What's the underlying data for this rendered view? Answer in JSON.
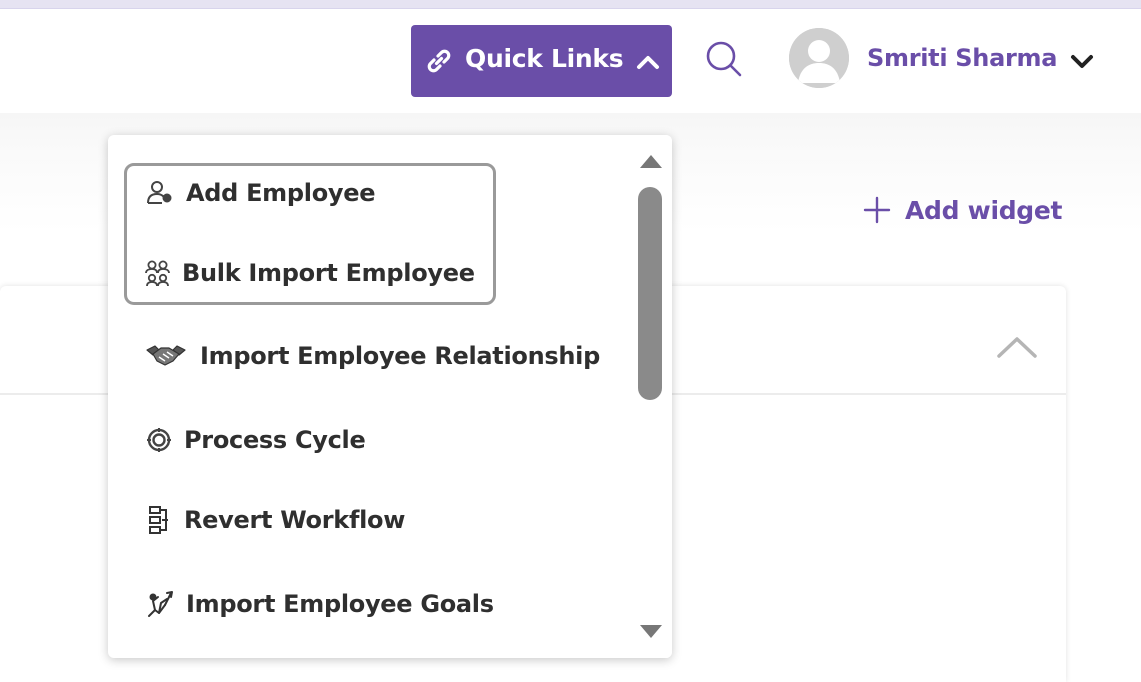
{
  "header": {
    "quick_links_label": "Quick Links",
    "user_name": "Smriti Sharma"
  },
  "dashboard": {
    "add_widget_label": "Add widget"
  },
  "quick_links_menu": {
    "items": [
      {
        "label": "Add Employee",
        "icon": "user-add-icon"
      },
      {
        "label": "Bulk Import Employee",
        "icon": "users-group-icon"
      },
      {
        "label": "Import Employee Relationship",
        "icon": "handshake-icon"
      },
      {
        "label": "Process Cycle",
        "icon": "cycle-icon"
      },
      {
        "label": "Revert Workflow",
        "icon": "workflow-icon"
      },
      {
        "label": "Import Employee Goals",
        "icon": "goals-icon"
      }
    ],
    "scroll_position": 0.0
  },
  "colors": {
    "accent": "#6a4ea8",
    "menu_text": "#2f2f2f",
    "highlight_border": "#9a9a9a"
  }
}
